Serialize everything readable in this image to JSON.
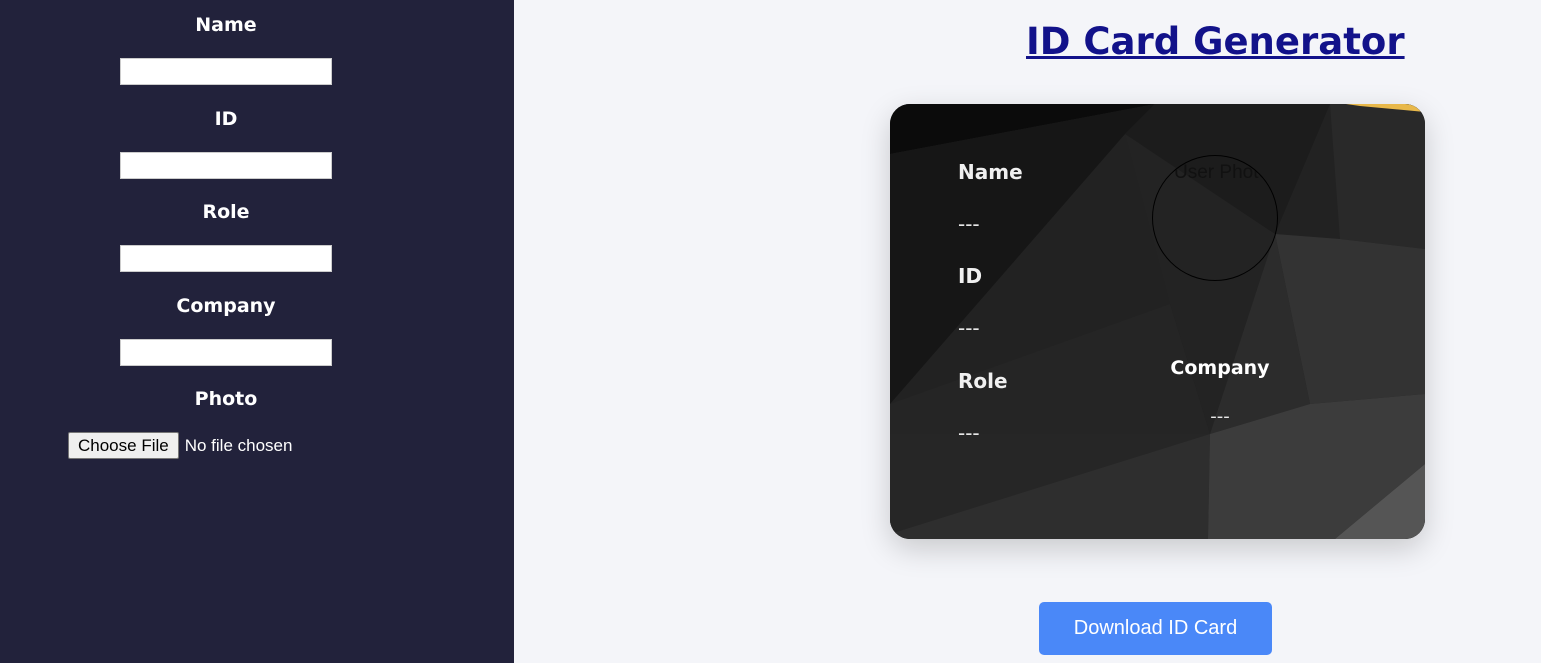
{
  "form": {
    "name_label": "Name",
    "id_label": "ID",
    "role_label": "Role",
    "company_label": "Company",
    "photo_label": "Photo",
    "name_value": "",
    "id_value": "",
    "role_value": "",
    "company_value": "",
    "file_button": "Choose File",
    "file_status": "No file chosen"
  },
  "main": {
    "title": "ID Card Generator",
    "download_label": "Download ID Card"
  },
  "card": {
    "name_label": "Name",
    "name_value": "---",
    "id_label": "ID",
    "id_value": "---",
    "role_label": "Role",
    "role_value": "---",
    "company_label": "Company",
    "company_value": "---",
    "photo_alt": "User Photo"
  },
  "colors": {
    "sidebar_bg": "#22223b",
    "title": "#12128a",
    "button": "#4a88f8",
    "card_accent": "#e8b84a"
  }
}
